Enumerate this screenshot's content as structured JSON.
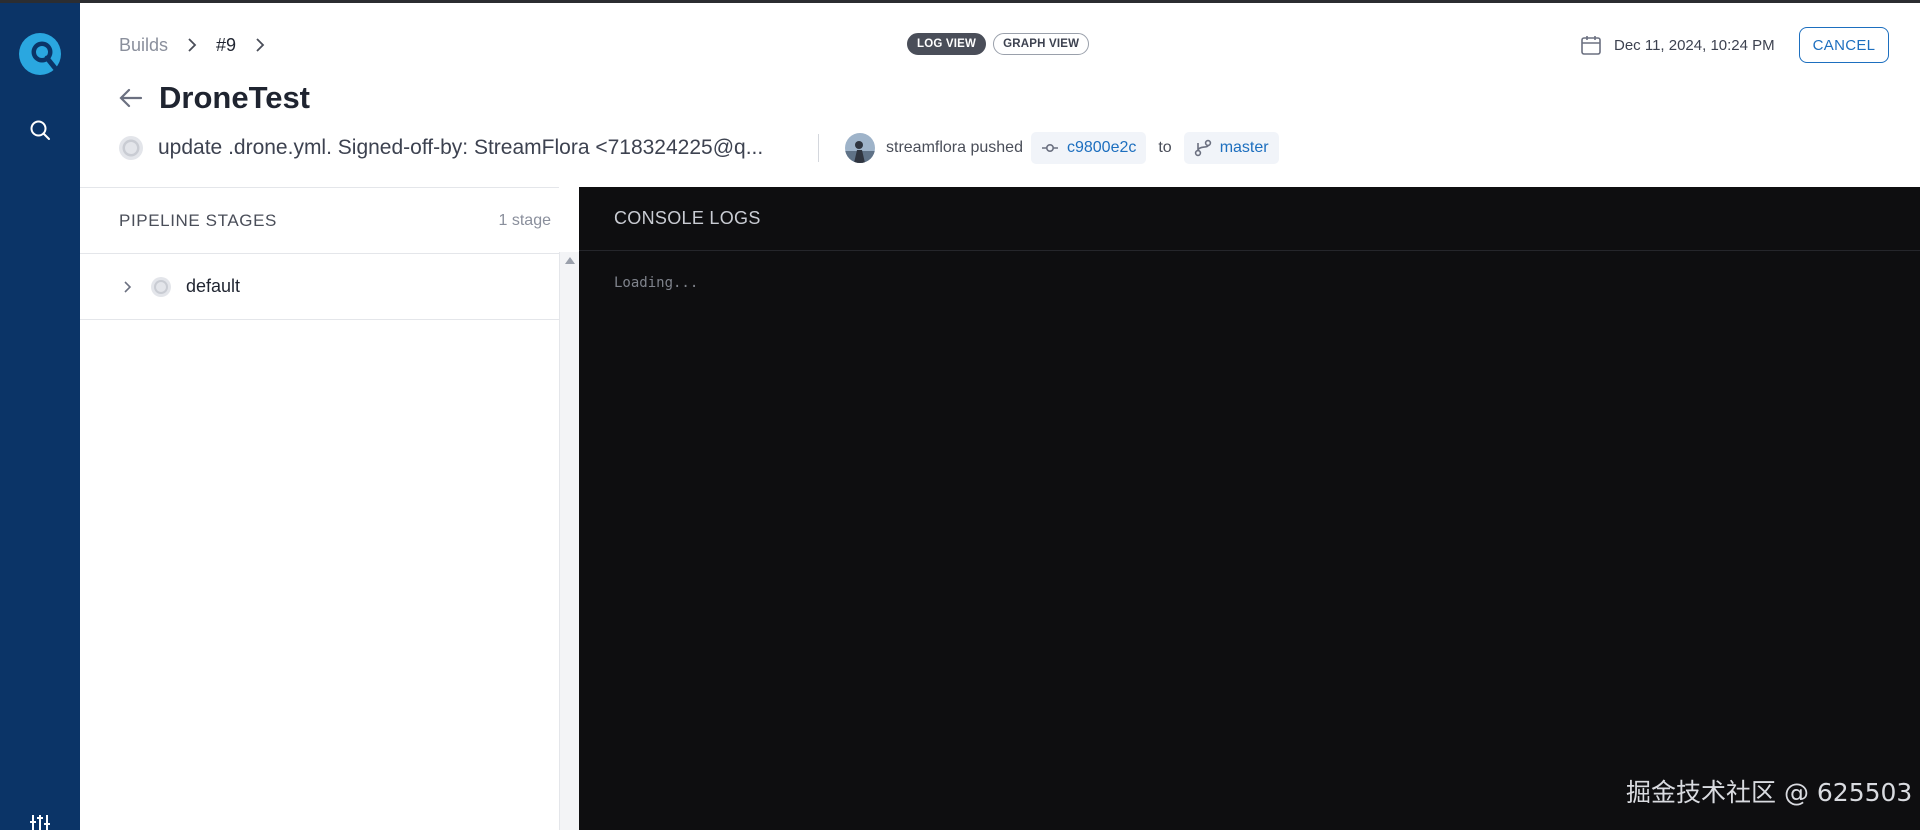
{
  "breadcrumb": {
    "root": "Builds",
    "build_number": "#9"
  },
  "view_toggle": {
    "log_view": "LOG VIEW",
    "graph_view": "GRAPH VIEW"
  },
  "header": {
    "date": "Dec 11, 2024, 10:24 PM",
    "cancel_label": "CANCEL",
    "title": "DroneTest"
  },
  "commit": {
    "message": "update .drone.yml. Signed-off-by: StreamFlora <718324225@q...",
    "author_action": "streamflora pushed",
    "sha": "c9800e2c",
    "to_word": "to",
    "branch": "master"
  },
  "stages": {
    "title": "PIPELINE STAGES",
    "count": "1 stage",
    "items": [
      {
        "name": "default"
      }
    ]
  },
  "console": {
    "title": "CONSOLE LOGS",
    "text": "Loading..."
  },
  "watermark": "掘金技术社区 @ 625503",
  "colors": {
    "sidebar": "#0b3467",
    "accent": "#1d6fbf",
    "console_bg": "#0e0e10",
    "logo": "#2aa7e0"
  },
  "icons": {
    "logo": "drone-logo-icon",
    "search": "search-icon",
    "settings": "sliders-icon",
    "calendar": "calendar-icon",
    "back": "arrow-left-icon",
    "commit": "git-commit-icon",
    "branch": "git-branch-icon"
  }
}
